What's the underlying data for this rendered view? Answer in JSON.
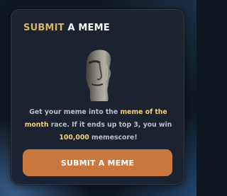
{
  "card": {
    "title_accent": "SUBMIT",
    "title_rest": " A MEME",
    "image_icon": "moai-icon",
    "description": {
      "part1": "Get your meme into the ",
      "highlight1": "meme of the month",
      "part2": " race. If it ends up top 3, you win ",
      "highlight2": "100,000",
      "part3": " memescore!"
    },
    "cta_label": "SUBMIT A MEME"
  },
  "colors": {
    "accent_gold": "#d8b46a",
    "highlight_text": "#f2cf7a",
    "button": "#c8783f",
    "card_bg": "#1c2330"
  }
}
